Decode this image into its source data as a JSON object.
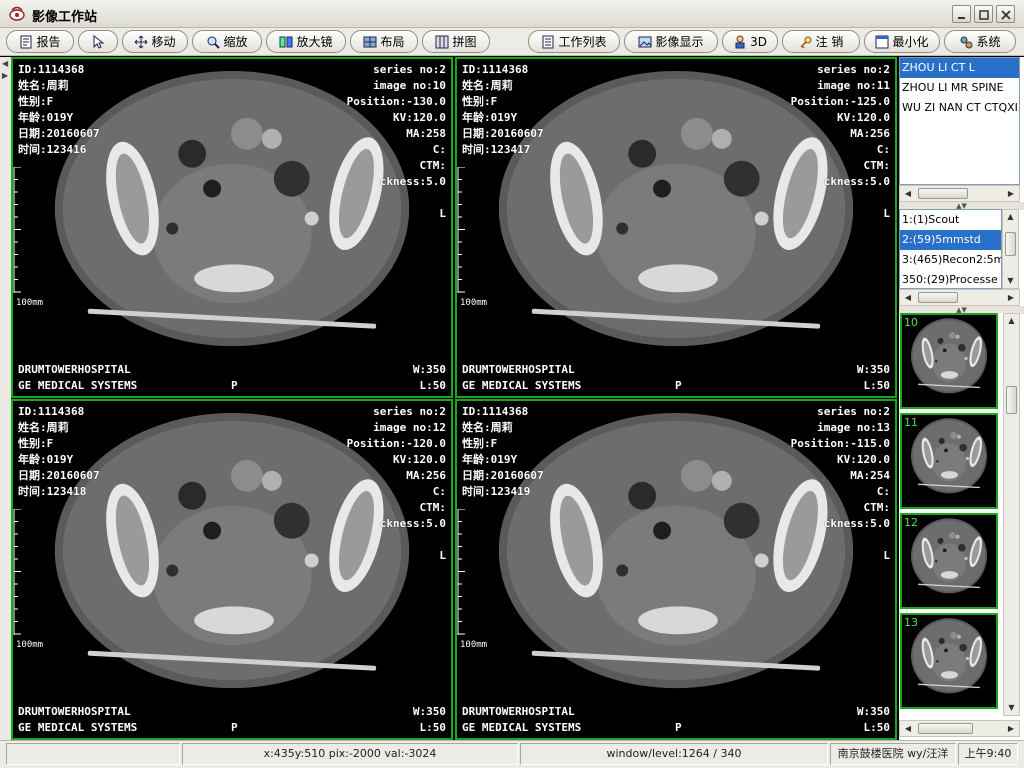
{
  "window": {
    "title": "影像工作站"
  },
  "toolbar": {
    "buttons": [
      {
        "label": "报告",
        "icon": "report-icon"
      },
      {
        "label": "",
        "icon": "pointer-icon"
      },
      {
        "label": "移动",
        "icon": "move-icon"
      },
      {
        "label": "缩放",
        "icon": "zoom-icon"
      },
      {
        "label": "放大镜",
        "icon": "magnifier-icon"
      },
      {
        "label": "布局",
        "icon": "layout-icon"
      },
      {
        "label": "拼图",
        "icon": "montage-icon"
      },
      {
        "label": "工作列表",
        "icon": "worklist-icon"
      },
      {
        "label": "影像显示",
        "icon": "image-display-icon"
      },
      {
        "label": "3D",
        "icon": "3d-icon"
      },
      {
        "label": "注 销",
        "icon": "logout-key-icon"
      },
      {
        "label": "最小化",
        "icon": "minimize-icon"
      },
      {
        "label": "系统",
        "icon": "system-icon"
      }
    ]
  },
  "viewports": [
    {
      "id": "ID:1114368",
      "name": "姓名:周莉",
      "sex": "性别:F",
      "age": "年龄:019Y",
      "date": "日期:20160607",
      "time": "时间:123416",
      "series": "series no:2",
      "image": "image no:10",
      "position": "Position:-130.0",
      "kv": "KV:120.0",
      "ma": "MA:258",
      "c": "C:",
      "ctm": "CTM:",
      "thickness": "ckness:5.0",
      "orient_right": "L",
      "orient_bottom": "P",
      "hospital": "DRUMTOWERHOSPITAL",
      "maker": "GE MEDICAL SYSTEMS",
      "w": "W:350",
      "l": "L:50",
      "scale": "100mm"
    },
    {
      "id": "ID:1114368",
      "name": "姓名:周莉",
      "sex": "性别:F",
      "age": "年龄:019Y",
      "date": "日期:20160607",
      "time": "时间:123417",
      "series": "series no:2",
      "image": "image no:11",
      "position": "Position:-125.0",
      "kv": "KV:120.0",
      "ma": "MA:256",
      "c": "C:",
      "ctm": "CTM:",
      "thickness": "ckness:5.0",
      "orient_right": "L",
      "orient_bottom": "P",
      "hospital": "DRUMTOWERHOSPITAL",
      "maker": "GE MEDICAL SYSTEMS",
      "w": "W:350",
      "l": "L:50",
      "scale": "100mm"
    },
    {
      "id": "ID:1114368",
      "name": "姓名:周莉",
      "sex": "性别:F",
      "age": "年龄:019Y",
      "date": "日期:20160607",
      "time": "时间:123418",
      "series": "series no:2",
      "image": "image no:12",
      "position": "Position:-120.0",
      "kv": "KV:120.0",
      "ma": "MA:256",
      "c": "C:",
      "ctm": "CTM:",
      "thickness": "ckness:5.0",
      "orient_right": "L",
      "orient_bottom": "P",
      "hospital": "DRUMTOWERHOSPITAL",
      "maker": "GE MEDICAL SYSTEMS",
      "w": "W:350",
      "l": "L:50",
      "scale": "100mm"
    },
    {
      "id": "ID:1114368",
      "name": "姓名:周莉",
      "sex": "性别:F",
      "age": "年龄:019Y",
      "date": "日期:20160607",
      "time": "时间:123419",
      "series": "series no:2",
      "image": "image no:13",
      "position": "Position:-115.0",
      "kv": "KV:120.0",
      "ma": "MA:254",
      "c": "C:",
      "ctm": "CTM:",
      "thickness": "ckness:5.0",
      "orient_right": "L",
      "orient_bottom": "P",
      "hospital": "DRUMTOWERHOSPITAL",
      "maker": "GE MEDICAL SYSTEMS",
      "w": "W:350",
      "l": "L:50",
      "scale": "100mm"
    }
  ],
  "patients": [
    {
      "label": "ZHOU LI CT L",
      "selected": true
    },
    {
      "label": "ZHOU LI MR SPINE",
      "selected": false
    },
    {
      "label": "WU ZI NAN CT CTQXI",
      "selected": false
    }
  ],
  "series_list": [
    {
      "label": "1:(1)Scout",
      "selected": false
    },
    {
      "label": "2:(59)5mmstd",
      "selected": true
    },
    {
      "label": "3:(465)Recon2:5m",
      "selected": false
    },
    {
      "label": "350:(29)Processe",
      "selected": false
    }
  ],
  "thumbnails": [
    "10",
    "11",
    "12",
    "13"
  ],
  "status": {
    "cell1": "",
    "coords": "x:435y:510 pix:-2000 val:-3024",
    "window_level": "window/level:1264 / 340",
    "hospital_user": "南京鼓楼医院 wy/汪洋",
    "clock": "上午9:40"
  },
  "colors": {
    "viewport_border": "#19a819",
    "selection": "#2870c8",
    "thumb_number": "#4ce24c"
  }
}
